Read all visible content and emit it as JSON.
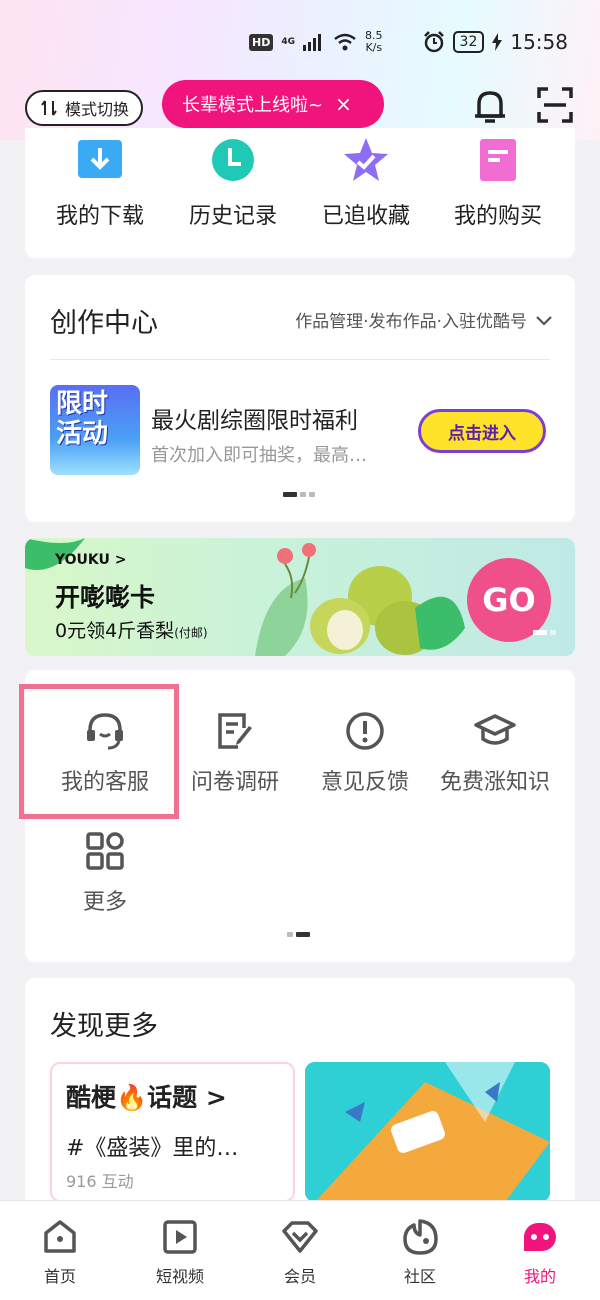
{
  "status_bar": {
    "hd": "HD",
    "network": "4G",
    "speed_value": "8.5",
    "speed_unit": "K/s",
    "battery": "32",
    "time": "15:58"
  },
  "header": {
    "mode_switch_label": "模式切换",
    "elder_toast": "长辈模式上线啦~",
    "toast_close": "×"
  },
  "quick_actions": [
    {
      "label": "我的下载",
      "icon": "download-icon",
      "color": "#3aaaf5"
    },
    {
      "label": "历史记录",
      "icon": "clock-icon",
      "color": "#20c9b6"
    },
    {
      "label": "已追收藏",
      "icon": "star-icon",
      "color": "#8e6cf5"
    },
    {
      "label": "我的购买",
      "icon": "bag-icon",
      "color": "#f26dd1"
    }
  ],
  "creation_center": {
    "title": "创作中心",
    "links": "作品管理·发布作品·入驻优酷号",
    "promo_thumb_text": "限时活动",
    "promo_title": "最火剧综圈限时福利",
    "promo_sub": "首次加入即可抽奖，最高…",
    "enter_button": "点击进入"
  },
  "banner": {
    "brand": "YOUKU >",
    "title": "开嘭嘭卡",
    "subtitle": "0元领4斤香梨",
    "subtitle_note": "(付邮)",
    "go": "GO"
  },
  "services": [
    {
      "label": "我的客服",
      "icon": "customer-service-icon"
    },
    {
      "label": "问卷调研",
      "icon": "survey-icon"
    },
    {
      "label": "意见反馈",
      "icon": "feedback-icon"
    },
    {
      "label": "免费涨知识",
      "icon": "graduation-cap-icon"
    },
    {
      "label": "更多",
      "icon": "grid-more-icon"
    }
  ],
  "discover": {
    "title": "发现更多",
    "topic_brand": "酷梗🔥话题",
    "topic_arrow": ">",
    "topic_text": "#《盛装》里的…",
    "topic_meta": "916 互动"
  },
  "tabbar": [
    {
      "label": "首页",
      "icon": "home-icon"
    },
    {
      "label": "短视频",
      "icon": "short-video-icon"
    },
    {
      "label": "会员",
      "icon": "vip-diamond-icon"
    },
    {
      "label": "社区",
      "icon": "community-icon"
    },
    {
      "label": "我的",
      "icon": "profile-icon",
      "active": true
    }
  ],
  "colors": {
    "accent": "#f0147c",
    "highlight_box": "#f07090"
  }
}
